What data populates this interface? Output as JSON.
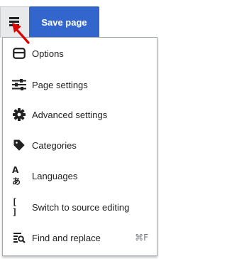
{
  "toolbar": {
    "menu_icon": "hamburger-icon",
    "save_label": "Save page",
    "accent_color": "#3366cc",
    "arrow_color": "#dd0000"
  },
  "menu": {
    "items": [
      {
        "label": "Options",
        "icon": "options-window-icon"
      },
      {
        "label": "Page settings",
        "icon": "sliders-icon"
      },
      {
        "label": "Advanced settings",
        "icon": "gear-icon"
      },
      {
        "label": "Categories",
        "icon": "tag-icon"
      },
      {
        "label": "Languages",
        "icon": "language-icon",
        "glyph": "Aあ"
      },
      {
        "label": "Switch to source editing",
        "icon": "brackets-icon",
        "glyph": "[ ]"
      },
      {
        "label": "Find and replace",
        "icon": "find-replace-icon",
        "shortcut": "⌘F"
      }
    ]
  }
}
